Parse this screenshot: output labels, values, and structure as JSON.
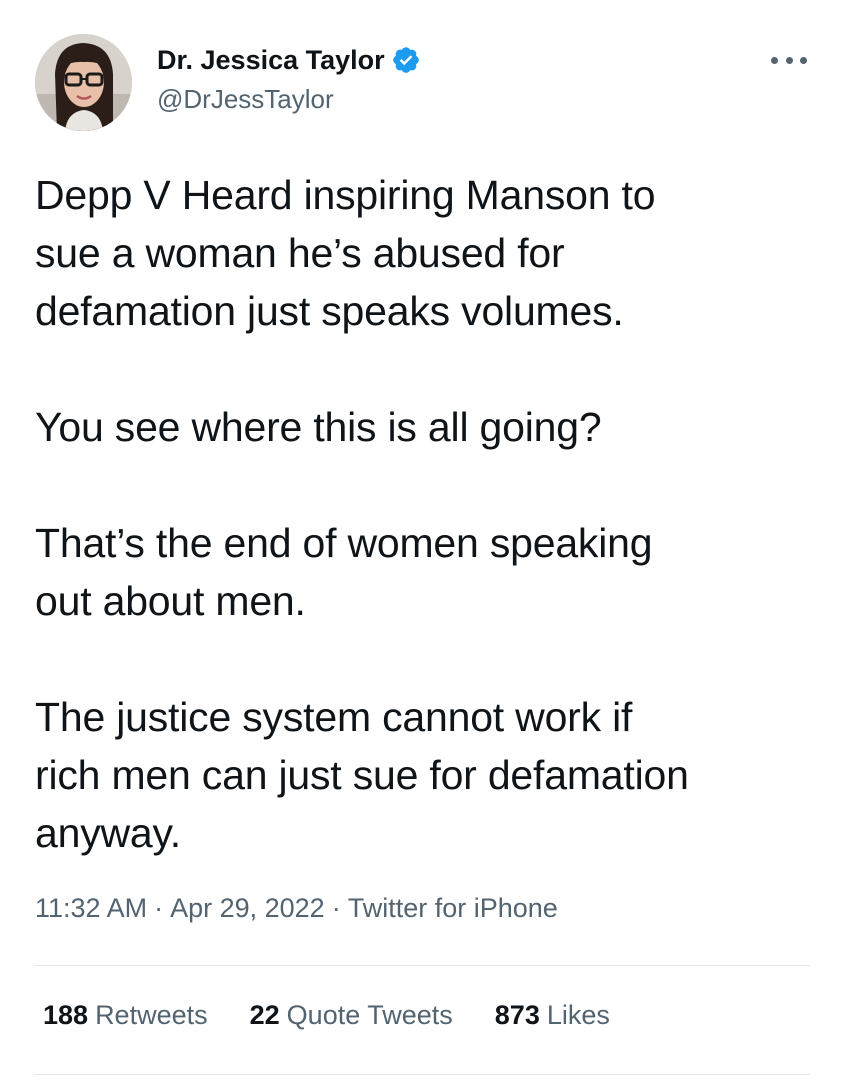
{
  "author": {
    "display_name": "Dr. Jessica Taylor",
    "handle": "@DrJessTaylor",
    "verified": true,
    "verified_color": "#1d9bf0"
  },
  "tweet": {
    "paragraphs": [
      "Depp V Heard inspiring Manson to\nsue a woman he’s abused  for\ndefamation just speaks volumes.",
      "You see where this is all going?",
      "That’s the end of women speaking\nout about men.",
      "The justice system cannot work if\nrich men can just sue for defamation\nanyway."
    ],
    "time": "11:32 AM",
    "date": "Apr 29, 2022",
    "source": "Twitter for iPhone",
    "separator": "·"
  },
  "stats": {
    "retweets": {
      "count": "188",
      "label": "Retweets"
    },
    "quote_tweets": {
      "count": "22",
      "label": "Quote Tweets"
    },
    "likes": {
      "count": "873",
      "label": "Likes"
    }
  },
  "icons": {
    "more": "more-horizontal-icon",
    "verified": "verified-badge-icon"
  },
  "colors": {
    "text": "#0f1419",
    "secondary": "#536471",
    "divider": "#e1e6ea"
  }
}
